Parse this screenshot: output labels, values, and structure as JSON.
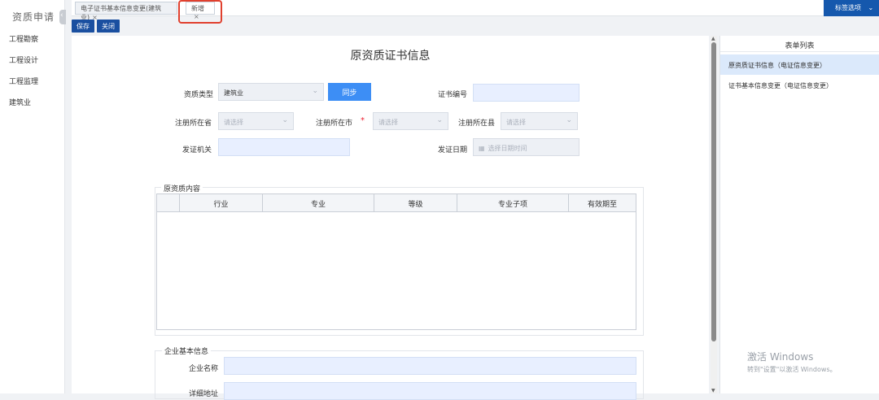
{
  "sidebar": {
    "title": "资质申请",
    "items": [
      {
        "label": "工程勘察"
      },
      {
        "label": "工程设计"
      },
      {
        "label": "工程监理"
      },
      {
        "label": "建筑业"
      }
    ]
  },
  "tabs": [
    {
      "label": "电子证书基本信息变更(建筑业)",
      "close": "×"
    },
    {
      "label": "新增",
      "close": "×"
    }
  ],
  "tab_options": {
    "label": "标签选项",
    "icon": "chevron-down-icon"
  },
  "toolbar": {
    "save_label": "保存",
    "close_label": "关闭"
  },
  "form": {
    "title": "原资质证书信息",
    "qual_type_label": "资质类型",
    "qual_type_value": "建筑业",
    "sync_label": "同步",
    "cert_no_label": "证书编号",
    "cert_no_value": "",
    "province_label": "注册所在省",
    "province_placeholder": "请选择",
    "city_label": "注册所在市",
    "city_placeholder": "请选择",
    "county_label": "注册所在县",
    "county_placeholder": "请选择",
    "required_mark": "*",
    "issuer_label": "发证机关",
    "issuer_value": "",
    "issue_date_label": "发证日期",
    "issue_date_placeholder": "选择日期时间"
  },
  "content_group": {
    "legend": "原资质内容",
    "columns": [
      "行业",
      "专业",
      "等级",
      "专业子项",
      "有效期至"
    ]
  },
  "company_group": {
    "legend": "企业基本信息",
    "name_label": "企业名称",
    "address_label": "详细地址"
  },
  "right_panel": {
    "title": "表单列表",
    "items": [
      {
        "label": "原资质证书信息（电证信息变更）",
        "active": true
      },
      {
        "label": "证书基本信息变更（电证信息变更）",
        "active": false
      }
    ]
  },
  "watermark": {
    "line1": "激活 Windows",
    "line2": "转到\"设置\"以激活 Windows。"
  }
}
